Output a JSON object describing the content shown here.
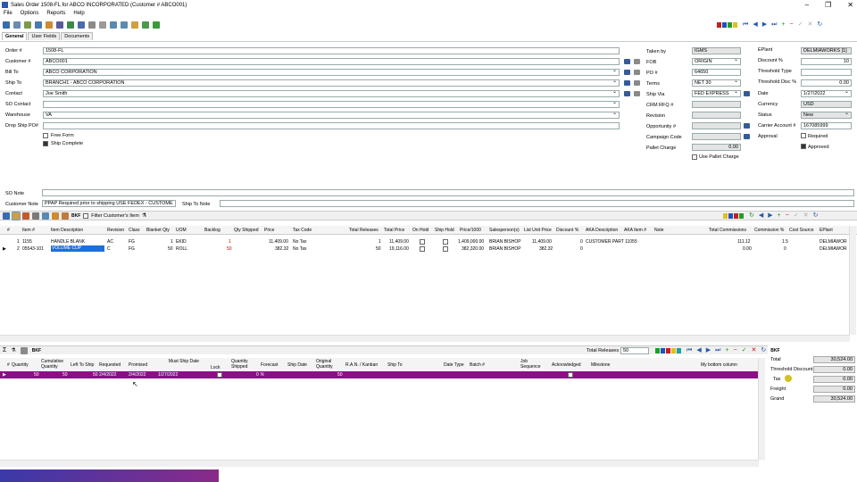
{
  "window": {
    "title": "Sales Order 1508-FL for ABCO INCORPORATED (Customer # ABCO001)"
  },
  "menu": [
    "File",
    "Options",
    "Reports",
    "Help"
  ],
  "tabs": [
    {
      "label": "General"
    },
    {
      "label": "User Fields"
    },
    {
      "label": "Documents"
    }
  ],
  "header": {
    "order_label": "Order #",
    "order_value": "1508-FL",
    "customer_label": "Customer #",
    "customer_value": "ABCO001",
    "bill_to_label": "Bill To",
    "bill_to_value": "ABCO CORPORATION",
    "ship_to_label": "Ship To",
    "ship_to_value": "BRANCH1 - ABCO CORPORATION",
    "contact_label": "Contact",
    "contact_value": "Joe Smith",
    "so_contact_label": "SO Contact",
    "so_contact_value": "",
    "warehouse_label": "Warehouse",
    "warehouse_value": "VA",
    "drop_ship_label": "Drop Ship PO#",
    "drop_ship_value": "",
    "free_form_label": "Free Form",
    "ship_complete_label": "Ship Complete",
    "so_note_label": "SO Note",
    "customer_note_label": "Customer Note",
    "customer_note_value": "PPAP Required prior to shipping USE FEDEX - CUSTOME",
    "ship_to_note_label": "Ship To Note"
  },
  "middle": {
    "taken_by_label": "Taken by",
    "taken_by_value": "IGMS",
    "fob_label": "FOB",
    "fob_value": "ORIGIN",
    "po_label": "PO #",
    "po_value": "64650",
    "terms_label": "Terms",
    "terms_value": "NET 30",
    "ship_via_label": "Ship Via",
    "ship_via_value": "FED EXPRESS",
    "crm_label": "CRM RFQ #",
    "revision_label": "Revision",
    "opportunity_label": "Opportunity #",
    "campaign_label": "Campaign Code",
    "pallet_label": "Pallet Charge",
    "pallet_value": "0.00",
    "use_pallet_label": "Use Pallet Charge"
  },
  "right": {
    "eplant_label": "EPlant",
    "eplant_value": "DELMIAWORKS [1]",
    "discount_label": "Discount %",
    "discount_value": "10",
    "threshold_type_label": "Threshold Type",
    "threshold_disc_label": "Threshold Disc %",
    "threshold_disc_value": "0.00",
    "date_label": "Date",
    "date_value": "1/27/2022",
    "currency_label": "Currency",
    "currency_value": "USD",
    "status_label": "Status",
    "status_value": "New",
    "carrier_label": "Carrier Account #",
    "carrier_value": "167085999",
    "approval_label": "Approval",
    "required_label": "Required",
    "approved_label": "Approved"
  },
  "grid1": {
    "filter_label": "Filter Customer's Item",
    "headers": [
      "#",
      "Item #",
      "Item Description",
      "Revision",
      "Class",
      "Blanket Qty",
      "UOM",
      "Backlog",
      "Qty Shipped",
      "Price",
      "Tax Code",
      "Total Releases",
      "Total Price",
      "On Hold",
      "Ship Hold",
      "Price/1000",
      "Salesperson(s)",
      "List Unit Price",
      "Discount %",
      "AKA Description",
      "AKA Item #",
      "Note",
      "Total Commissions",
      "Commission %",
      "Cost Source",
      "EPlant"
    ],
    "rows": [
      {
        "n": "1",
        "item": "1155",
        "desc": "HANDLE BLANK",
        "rev": "AC",
        "cls": "FG",
        "bqty": "1",
        "uom": "EKID",
        "backlog": "1",
        "shipped": "",
        "price": "11,409.00",
        "tax": "No Tax",
        "rel": "1",
        "total": "11,409.00",
        "p1000": "1,409,000.00",
        "sales": "BRIAN BISHOP",
        "list": "11,409.00",
        "disc": "0",
        "aka_desc": "CUSTOMER PART 11055",
        "comm": "111.12",
        "commpct": "1.5",
        "eplant": "DELMIAWOR"
      },
      {
        "n": "2",
        "item": "05543-101",
        "desc": "VOLUME CUP",
        "rev": "C",
        "cls": "FG",
        "bqty": "50",
        "uom": "ROLL",
        "backlog": "50",
        "shipped": "",
        "price": "382.32",
        "tax": "No Tax",
        "rel": "50",
        "total": "19,116.00",
        "p1000": "382,320.00",
        "sales": "BRIAN BISHOP",
        "list": "382.32",
        "disc": "0",
        "aka_desc": "",
        "comm": "0.00",
        "commpct": "0",
        "eplant": "DELMIAWOR"
      }
    ]
  },
  "grid2": {
    "total_releases_label": "Total Releases",
    "total_releases_value": "50",
    "headers": [
      "#",
      "Quantity",
      "Cumulative Quantity",
      "Left To Ship",
      "Requested",
      "Promised",
      "Must Ship Date",
      "Lock",
      "Quantity Shipped",
      "Forecast",
      "Ship Date",
      "Original Quantity",
      "R.A.N. / Kanban",
      "Ship To",
      "Date Type",
      "Batch #",
      "Job Sequence",
      "Acknowledged",
      "Milestone",
      "My bottom column"
    ],
    "row": {
      "qty": "50",
      "cum": "50",
      "left": "50",
      "req": "2/4/2022",
      "prom": "2/4/2022",
      "must": "1/27/2022",
      "shipped": "0",
      "forecast": "N",
      "orig": "50"
    }
  },
  "totals": {
    "total_label": "Total",
    "total_value": "30,524.00",
    "threshold_label": "Threshold Discount",
    "threshold_value": "0.00",
    "tax_label": "Tax",
    "tax_value": "0.00",
    "freight_label": "Freight",
    "freight_value": "0.00",
    "grand_label": "Grand",
    "grand_value": "30,524.00"
  },
  "colors": {
    "selected_row": "#8b0f86",
    "highlight_cell": "#1e6fd9",
    "accent_red": "#cc0000"
  }
}
